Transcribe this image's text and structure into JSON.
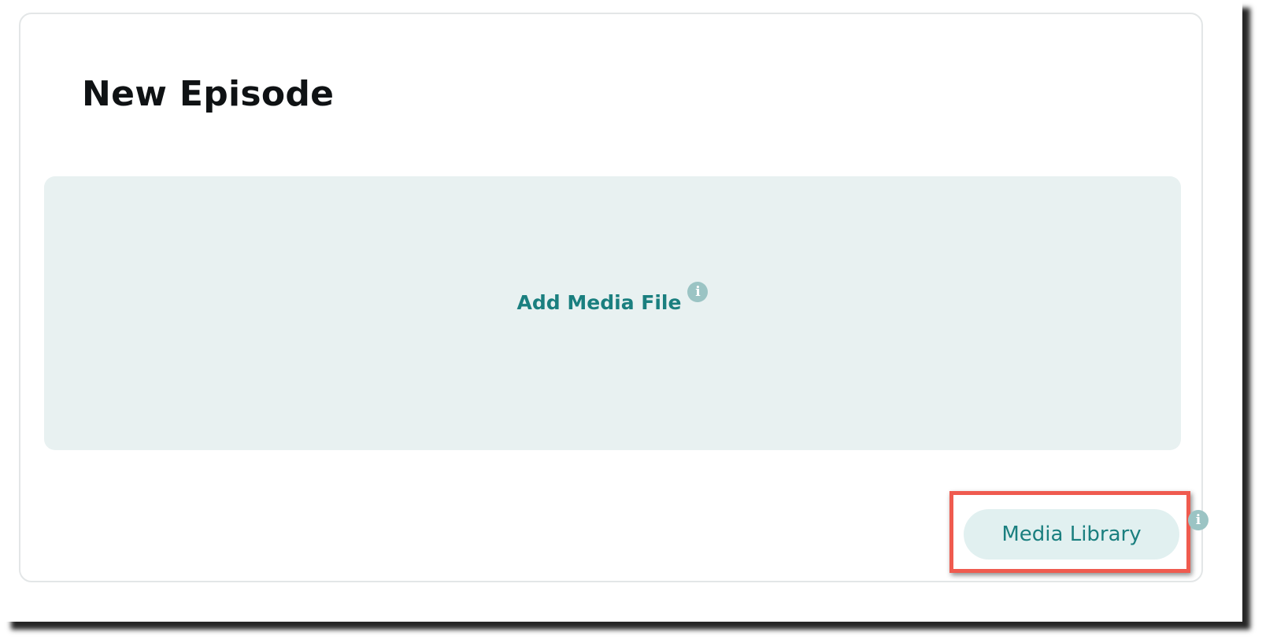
{
  "page": {
    "title": "New Episode"
  },
  "upload": {
    "label": "Add Media File",
    "info_icon": "info-icon"
  },
  "library": {
    "button_label": "Media Library",
    "info_icon": "info-icon"
  },
  "colors": {
    "accent": "#1a7f7f",
    "dropzone_bg": "#e8f1f1",
    "button_bg": "#e1f0f0",
    "info_icon": "#9bc4c4",
    "highlight": "#ef5b4f"
  }
}
